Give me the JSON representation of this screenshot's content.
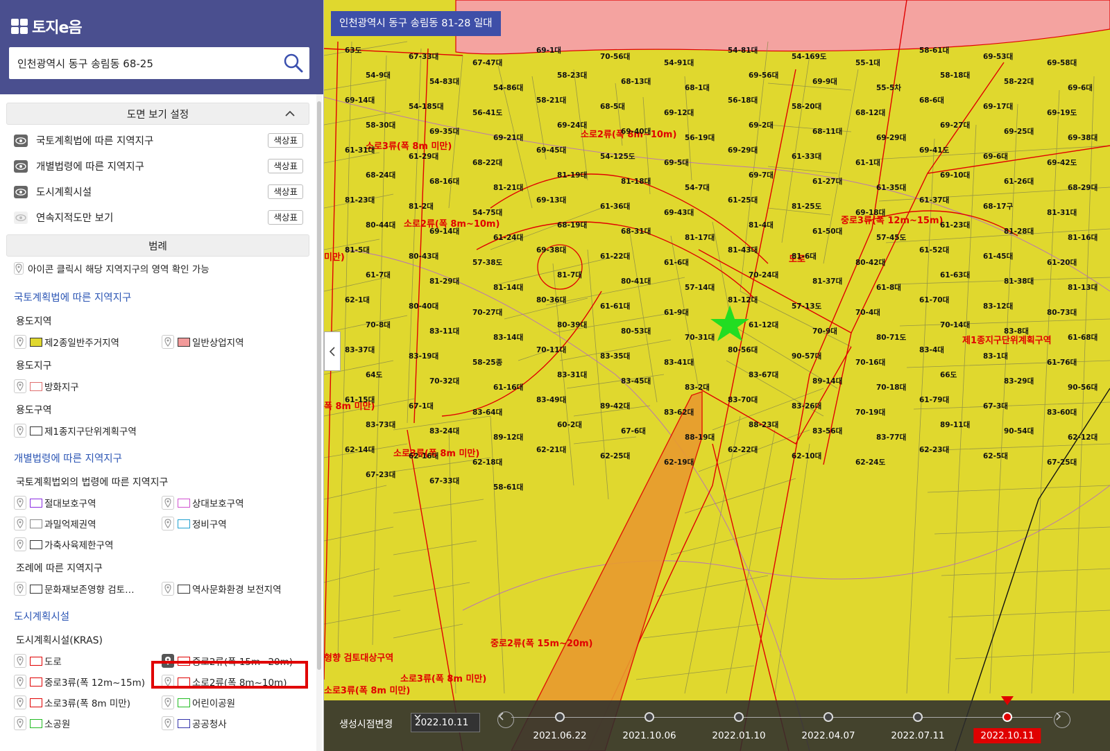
{
  "app": {
    "logo_text": "토지e음"
  },
  "search": {
    "value": "인천광역시 동구 송림동 68-25"
  },
  "view_settings": {
    "title": "도면 보기 설정",
    "layers": [
      {
        "label": "국토계획법에 따른 지역지구",
        "button": "색상표",
        "visible": true
      },
      {
        "label": "개별법령에 따른 지역지구",
        "button": "색상표",
        "visible": true
      },
      {
        "label": "도시계획시설",
        "button": "색상표",
        "visible": true
      },
      {
        "label": "연속지적도만 보기",
        "button": "색상표",
        "visible": false
      }
    ]
  },
  "legend": {
    "title": "범례",
    "note": "아이콘 클릭시 해당 지역지구의 영역 확인 가능",
    "group1": {
      "title": "국토계획법에 따른 지역지구",
      "sub1": {
        "title": "용도지역",
        "items": [
          {
            "label": "제2종일반주거지역",
            "fill": "#e0d82e",
            "stroke": "#333"
          },
          {
            "label": "일반상업지역",
            "fill": "#f29a9a",
            "stroke": "#333"
          }
        ]
      },
      "sub2": {
        "title": "용도지구",
        "items": [
          {
            "label": "방화지구",
            "fill": "#ffffff",
            "stroke": "#e07070"
          }
        ]
      },
      "sub3": {
        "title": "용도구역",
        "items": [
          {
            "label": "제1종지구단위계획구역",
            "fill": "#ffffff",
            "stroke": "#333"
          }
        ]
      }
    },
    "group2": {
      "title": "개별법령에 따른 지역지구",
      "sub1": {
        "title": "국토계획법외의 법령에 따른 지역지구",
        "items": [
          {
            "label": "절대보호구역",
            "fill": "#ffffff",
            "stroke": "#8a2be2"
          },
          {
            "label": "상대보호구역",
            "fill": "#ffffff",
            "stroke": "#d050d0"
          },
          {
            "label": "과밀억제권역",
            "fill": "#ffffff",
            "stroke": "#888"
          },
          {
            "label": "정비구역",
            "fill": "#ffffff",
            "stroke": "#20a0d0"
          },
          {
            "label": "가축사육제한구역",
            "fill": "#ffffff",
            "stroke": "#333"
          }
        ]
      },
      "sub2": {
        "title": "조례에 따른 지역지구",
        "items": [
          {
            "label": "문화재보존영향 검토…",
            "fill": "#ffffff",
            "stroke": "#333"
          },
          {
            "label": "역사문화환경 보전지역",
            "fill": "#ffffff",
            "stroke": "#333"
          }
        ]
      }
    },
    "group3": {
      "title": "도시계획시설",
      "sub1": {
        "title": "도시계획시설(KRAS)",
        "items": [
          {
            "label": "도로",
            "fill": "#ffffff",
            "stroke": "#e00000"
          },
          {
            "label": "중로2류(폭 15m~20m)",
            "fill": "#ffffff",
            "stroke": "#e00000",
            "active": true
          },
          {
            "label": "중로3류(폭 12m~15m)",
            "fill": "#ffffff",
            "stroke": "#e00000"
          },
          {
            "label": "소로2류(폭 8m~10m)",
            "fill": "#ffffff",
            "stroke": "#e00000"
          },
          {
            "label": "소로3류(폭 8m 미만)",
            "fill": "#ffffff",
            "stroke": "#e00000"
          },
          {
            "label": "어린이공원",
            "fill": "#ffffff",
            "stroke": "#22bb22"
          },
          {
            "label": "소공원",
            "fill": "#ffffff",
            "stroke": "#22bb22"
          },
          {
            "label": "공공청사",
            "fill": "#ffffff",
            "stroke": "#3333aa"
          }
        ]
      }
    }
  },
  "map": {
    "address_label": "인천광역시 동구 송림동 81-28 일대",
    "colors": {
      "residential": "#e0d82e",
      "commercial": "#f4a3a0",
      "road_facility": "#e89b2f",
      "boundary": "#e00000",
      "parcel": "#8a8a4a",
      "marker": "#22dd22"
    },
    "road_labels": [
      "소로3류(폭 8m 미만)",
      "소로2류(폭 8m~10m)",
      "소로2류(폭 8m~10m)",
      "중로3류(폭 12m~15m)",
      "도로",
      "제1종지구단위계획구역",
      "중로2류(폭 15m~20m)",
      "소로3류(폭 8m 미만)",
      "소로3류(폭 8m 미만)",
      "폭 8m 미만)",
      "미만)",
      "형향 검토대상구역",
      "소로3류(폭 8m 미만)"
    ],
    "parcel_labels": [
      "63도",
      "67-33대",
      "67-47대",
      "69-1대",
      "70-56대",
      "54-91대",
      "54-81대",
      "54-169도",
      "55-1대",
      "58-61대",
      "69-53대",
      "69-58대",
      "54-9대",
      "54-83대",
      "54-86대",
      "58-23대",
      "68-13대",
      "68-1대",
      "69-56대",
      "69-9대",
      "55-5차",
      "58-18대",
      "58-22대",
      "69-6대",
      "69-14대",
      "54-185대",
      "56-41도",
      "58-21대",
      "68-5대",
      "69-12대",
      "56-18대",
      "58-20대",
      "68-12대",
      "68-6대",
      "69-17대",
      "69-19도",
      "58-30대",
      "69-35대",
      "69-21대",
      "69-24대",
      "69-40대",
      "56-19대",
      "69-2대",
      "68-11대",
      "69-29대",
      "69-27대",
      "69-25대",
      "69-38대",
      "61-31대",
      "61-29대",
      "68-22대",
      "69-45대",
      "54-125도",
      "69-5대",
      "69-29대",
      "61-33대",
      "61-1대",
      "69-41도",
      "69-6대",
      "69-42도",
      "68-24대",
      "68-16대",
      "81-21대",
      "81-19대",
      "81-18대",
      "54-7대",
      "69-7대",
      "61-27대",
      "61-35대",
      "69-10대",
      "61-26대",
      "68-29대",
      "81-23대",
      "81-2대",
      "54-75대",
      "69-13대",
      "61-36대",
      "69-43대",
      "61-25대",
      "81-25도",
      "69-18대",
      "61-37대",
      "68-17구",
      "81-31대",
      "80-44대",
      "69-14대",
      "61-24대",
      "68-19대",
      "68-31대",
      "81-17대",
      "81-4대",
      "61-50대",
      "57-45도",
      "61-23대",
      "81-28대",
      "81-16대",
      "81-5대",
      "80-43대",
      "57-38도",
      "69-38대",
      "61-22대",
      "61-6대",
      "81-43대",
      "81-6대",
      "80-42대",
      "61-52대",
      "61-45대",
      "61-20대",
      "61-7대",
      "81-29대",
      "81-14대",
      "81-7대",
      "80-41대",
      "57-14대",
      "70-24대",
      "81-37대",
      "61-8대",
      "61-63대",
      "81-38대",
      "81-13대",
      "62-1대",
      "80-40대",
      "70-27대",
      "80-36대",
      "61-61대",
      "61-9대",
      "81-12대",
      "57-13도",
      "70-4대",
      "61-70대",
      "83-12대",
      "80-73대",
      "70-8대",
      "83-11대",
      "83-14대",
      "80-39대",
      "80-53대",
      "70-31대",
      "61-12대",
      "70-9대",
      "80-71도",
      "70-14대",
      "83-8대",
      "61-68대",
      "83-37대",
      "83-19대",
      "58-25종",
      "70-11대",
      "83-35대",
      "83-41대",
      "80-56대",
      "90-57대",
      "70-16대",
      "83-4대",
      "83-1대",
      "61-76대",
      "64도",
      "70-32대",
      "61-16대",
      "83-31대",
      "83-45대",
      "83-2대",
      "83-67대",
      "89-14대",
      "70-18대",
      "66도",
      "83-29대",
      "90-56대",
      "61-15대",
      "67-1대",
      "83-64대",
      "83-49대",
      "89-42대",
      "83-62대",
      "83-70대",
      "83-26대",
      "70-19대",
      "61-79대",
      "67-3대",
      "83-60대",
      "83-73대",
      "83-24대",
      "89-12대",
      "60-2대",
      "67-6대",
      "88-19대",
      "88-23대",
      "83-56대",
      "83-77대",
      "89-11대",
      "90-54대",
      "62-12대",
      "62-14대",
      "62-16대",
      "62-18대",
      "62-21대",
      "62-25대",
      "62-19대",
      "62-22대",
      "62-10대",
      "62-24도",
      "62-23대",
      "62-5대",
      "67-25대",
      "67-23대",
      "67-33대",
      "58-61대"
    ]
  },
  "timeline": {
    "label": "생성시점변경",
    "selected": "2022.10.11",
    "dates": [
      "2021.06.22",
      "2021.10.06",
      "2022.01.10",
      "2022.04.07",
      "2022.07.11",
      "2022.10.11"
    ]
  }
}
